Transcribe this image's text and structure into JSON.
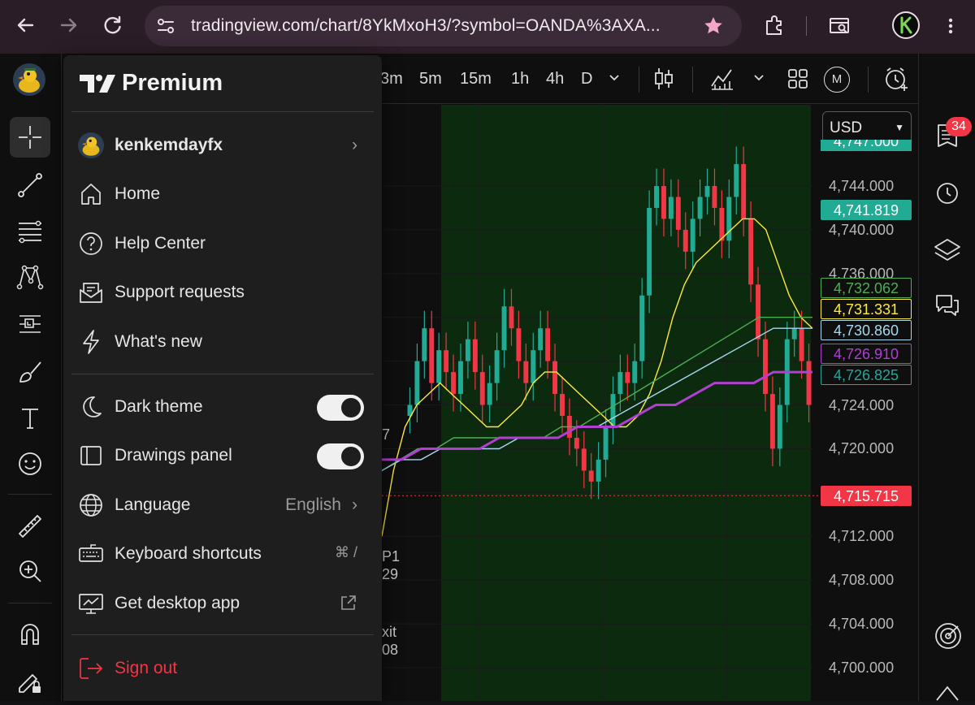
{
  "browser": {
    "url": "tradingview.com/chart/8YkMxoH3/?symbol=OANDA%3AXA...",
    "profile_initial": "K"
  },
  "toolbar": {
    "timeframes": [
      "3m",
      "5m",
      "15m",
      "1h",
      "4h",
      "D"
    ],
    "currency": "USD"
  },
  "menu": {
    "brand": "Premium",
    "username": "kenkemdayfx",
    "items_group1": [
      {
        "label": "Home",
        "icon": "home-icon"
      },
      {
        "label": "Help Center",
        "icon": "help-icon"
      },
      {
        "label": "Support requests",
        "icon": "support-icon"
      },
      {
        "label": "What's new",
        "icon": "lightning-icon"
      }
    ],
    "dark_theme": {
      "label": "Dark theme",
      "on": true
    },
    "drawings_panel": {
      "label": "Drawings panel",
      "on": true
    },
    "language": {
      "label": "Language",
      "value": "English"
    },
    "keyboard_shortcuts": {
      "label": "Keyboard shortcuts",
      "shortcut": "⌘ /"
    },
    "desktop_app": {
      "label": "Get desktop app"
    },
    "sign_out": {
      "label": "Sign out"
    }
  },
  "notifications": {
    "count": "34"
  },
  "chart_peek": {
    "text1": "7",
    "text2": "P1",
    "text3": "29",
    "text4": "xit",
    "text5": "08"
  },
  "price_scale": {
    "top_partial": "4,747.000",
    "labels": [
      "4,744.000",
      "4,740.000",
      "4,736.000",
      "4,724.000",
      "4,720.000",
      "4,712.000",
      "4,708.000",
      "4,704.000",
      "4,700.000"
    ],
    "tags": [
      {
        "value": "4,741.819",
        "bg": "#22ab94",
        "fg": "#ffffff",
        "border": "#22ab94"
      },
      {
        "value": "4,732.062",
        "bg": "#0f0f0f",
        "fg": "#4caf50",
        "border": "#4caf50"
      },
      {
        "value": "4,731.331",
        "bg": "#0f0f0f",
        "fg": "#ffeb3b",
        "border": "#ffeb3b"
      },
      {
        "value": "4,730.860",
        "bg": "#0f0f0f",
        "fg": "#a7d8f0",
        "border": "#a7d8f0"
      },
      {
        "value": "4,726.910",
        "bg": "#0f0f0f",
        "fg": "#b13fd1",
        "border": "#b13fd1"
      },
      {
        "value": "4,726.825",
        "bg": "#0f0f0f",
        "fg": "#26a69a",
        "border": "#26a69a"
      },
      {
        "value": "4,715.715",
        "bg": "#f23645",
        "fg": "#ffffff",
        "border": "#f23645"
      }
    ]
  },
  "colors": {
    "up": "#22ab94",
    "down": "#f23645",
    "session_bg": "#0c2a0e",
    "accent_red": "#f23645"
  },
  "chart_data": {
    "type": "line",
    "title": "",
    "ylabel": "",
    "ylim": [
      4698,
      4748
    ],
    "price": [
      4724,
      4728,
      4731,
      4726,
      4729,
      4727,
      4725,
      4728,
      4730,
      4727,
      4724,
      4726,
      4729,
      4733,
      4731,
      4728,
      4726,
      4729,
      4731,
      4728,
      4725,
      4723,
      4721,
      4720,
      4718,
      4717,
      4719,
      4722,
      4725,
      4727,
      4726,
      4728,
      4734,
      4742,
      4744,
      4741,
      4743,
      4740,
      4738,
      4741,
      4743,
      4744,
      4742,
      4739,
      4743,
      4746,
      4741,
      4735,
      4730,
      4725,
      4720,
      4724,
      4730,
      4731,
      4728,
      4724
    ],
    "series": [
      {
        "name": "MA yellow",
        "color": "#ffeb3b",
        "values": [
          4712,
          4718,
          4722,
          4724,
          4725,
          4726,
          4725,
          4724,
          4723,
          4722,
          4722,
          4723,
          4724,
          4726,
          4727,
          4727,
          4726,
          4725,
          4724,
          4723,
          4722,
          4722,
          4723,
          4725,
          4728,
          4732,
          4735,
          4737,
          4738,
          4739,
          4740,
          4741,
          4741,
          4740,
          4737,
          4734,
          4732,
          4731
        ]
      },
      {
        "name": "MA green",
        "color": "#4caf50",
        "values": [
          4718,
          4719,
          4720,
          4720,
          4721,
          4721,
          4721,
          4721,
          4721,
          4721,
          4722,
          4722,
          4723,
          4724,
          4725,
          4726,
          4727,
          4728,
          4729,
          4730,
          4731,
          4732,
          4732,
          4732,
          4732
        ]
      },
      {
        "name": "MA light blue",
        "color": "#a7d8f0",
        "values": [
          4718,
          4719,
          4719,
          4720,
          4720,
          4720,
          4720,
          4721,
          4721,
          4721,
          4722,
          4722,
          4723,
          4724,
          4725,
          4726,
          4727,
          4728,
          4729,
          4730,
          4731,
          4731,
          4731
        ]
      },
      {
        "name": "MA purple",
        "color": "#b13fd1",
        "values": [
          4719,
          4719,
          4720,
          4720,
          4720,
          4720,
          4721,
          4721,
          4721,
          4721,
          4722,
          4722,
          4722,
          4723,
          4724,
          4724,
          4725,
          4726,
          4726,
          4726,
          4727,
          4727,
          4727
        ]
      }
    ]
  }
}
